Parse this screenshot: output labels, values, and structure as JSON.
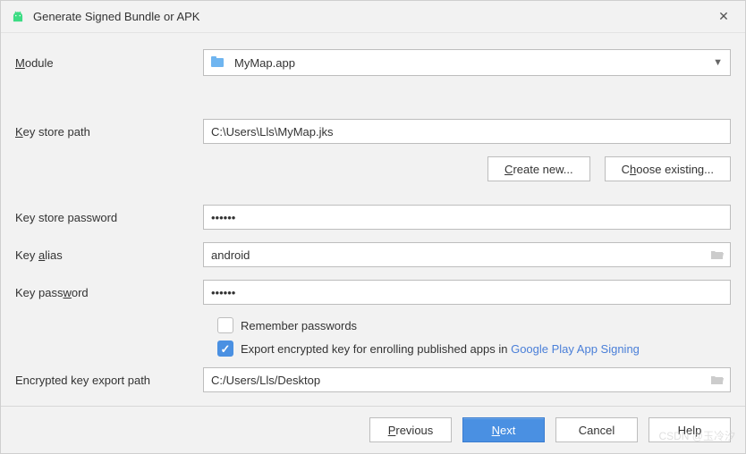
{
  "window": {
    "title": "Generate Signed Bundle or APK"
  },
  "labels": {
    "module": "Module",
    "key_store_path": "Key store path",
    "key_store_password": "Key store password",
    "key_alias": "Key alias",
    "key_password": "Key password",
    "encrypted_key_export_path": "Encrypted key export path"
  },
  "fields": {
    "module": "MyMap.app",
    "key_store_path": "C:\\Users\\Lls\\MyMap.jks",
    "key_store_password": "••••••",
    "key_alias": "android",
    "key_password": "••••••",
    "encrypted_key_export_path": "C:/Users/Lls/Desktop"
  },
  "buttons": {
    "create_new": "Create new...",
    "choose_existing": "Choose existing...",
    "previous": "Previous",
    "next": "Next",
    "cancel": "Cancel",
    "help": "Help"
  },
  "checks": {
    "remember_passwords": {
      "checked": false,
      "label": "Remember passwords"
    },
    "export_encrypted": {
      "checked": true,
      "label_pre": "Export encrypted key for enrolling published apps in ",
      "link": "Google Play App Signing"
    }
  },
  "watermark": "CSDN @玉冷汐"
}
